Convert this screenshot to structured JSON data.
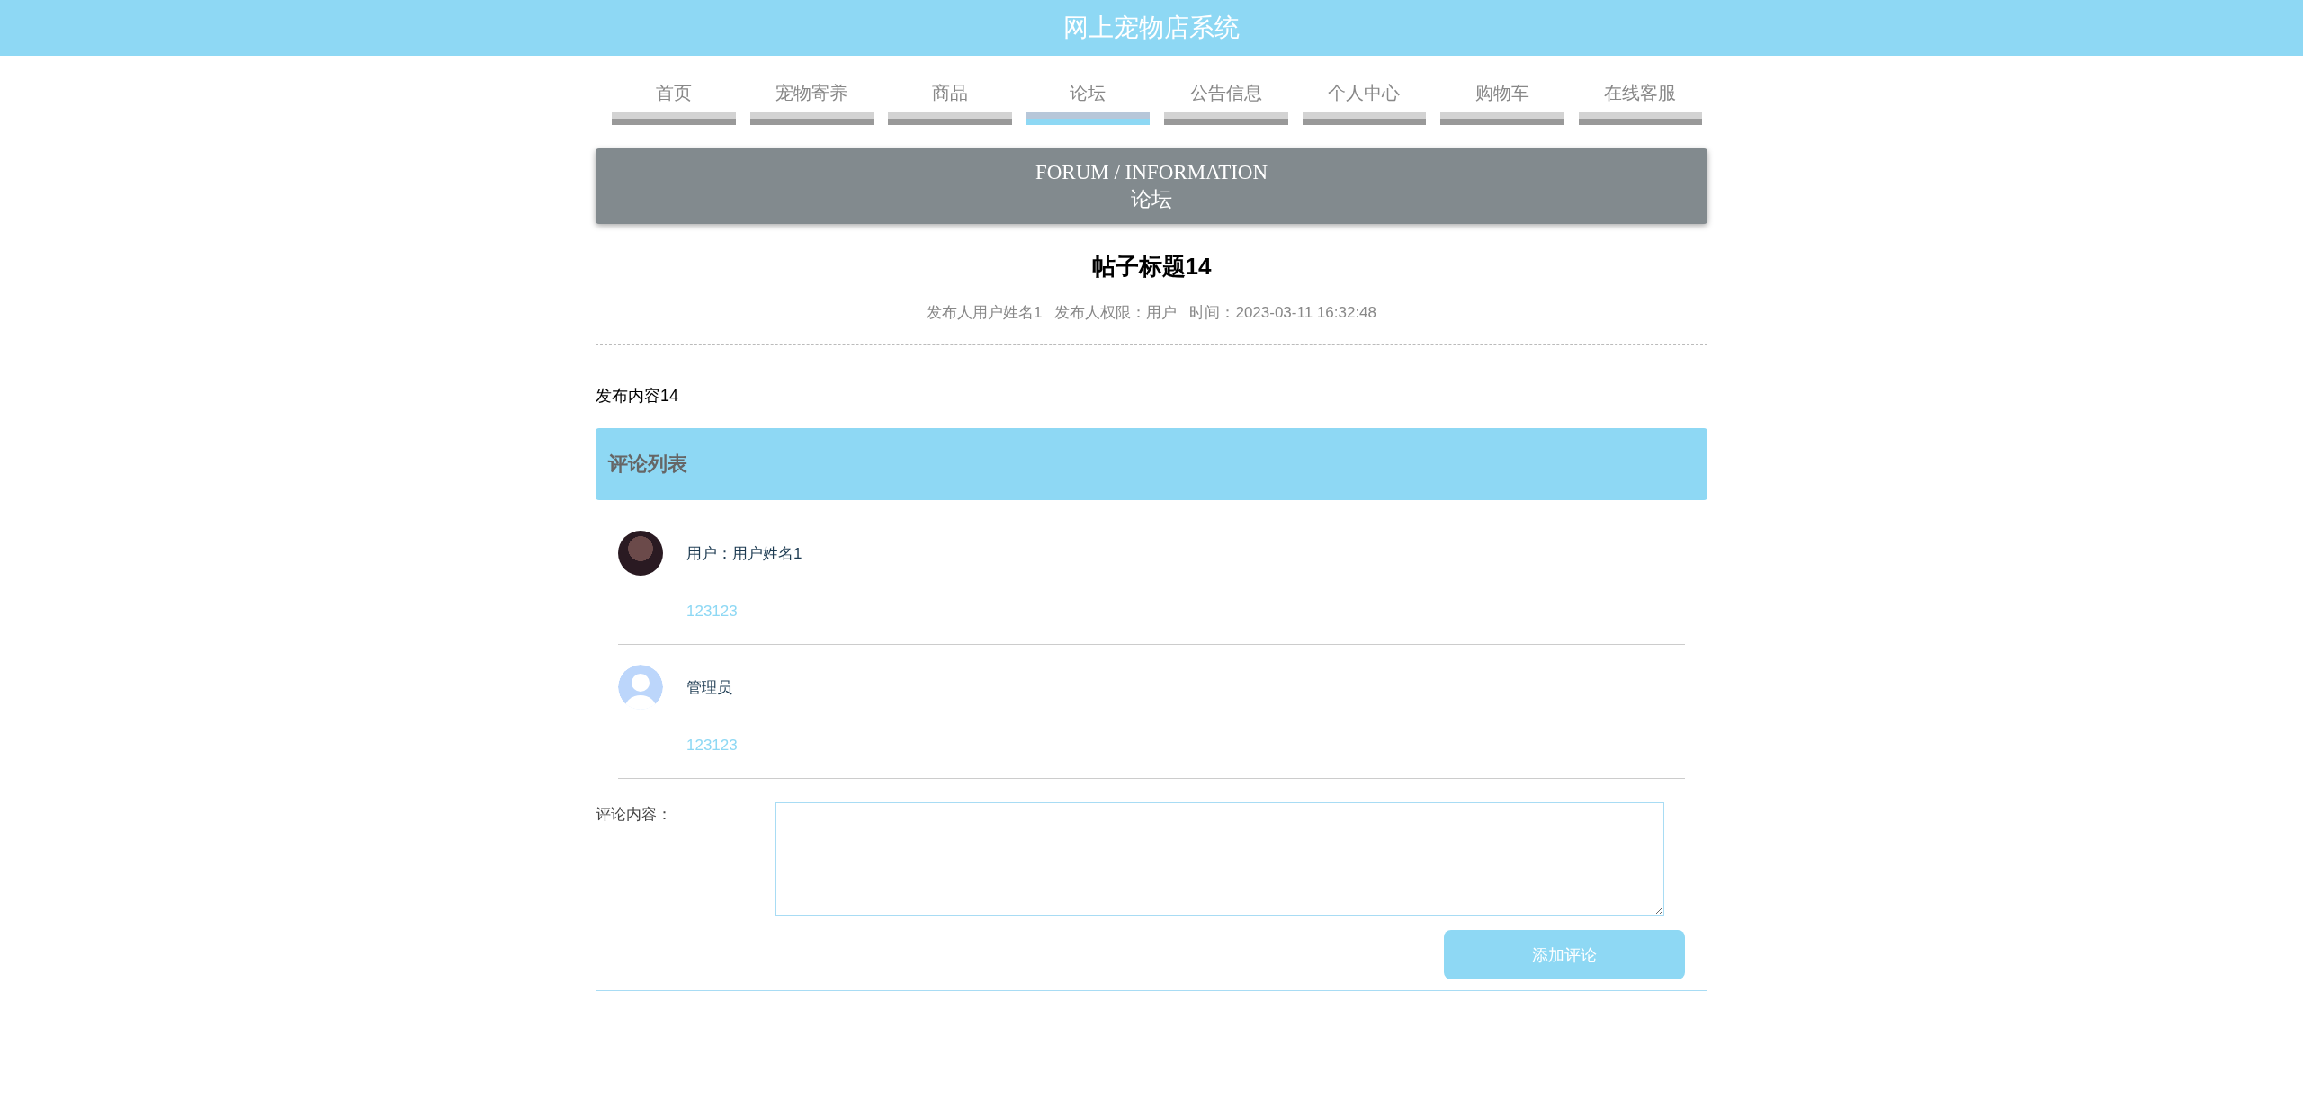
{
  "header": {
    "title": "网上宠物店系统"
  },
  "nav": [
    {
      "label": "首页",
      "selected": false
    },
    {
      "label": "宠物寄养",
      "selected": false
    },
    {
      "label": "商品",
      "selected": false
    },
    {
      "label": "论坛",
      "selected": true
    },
    {
      "label": "公告信息",
      "selected": false
    },
    {
      "label": "个人中心",
      "selected": false
    },
    {
      "label": "购物车",
      "selected": false
    },
    {
      "label": "在线客服",
      "selected": false
    }
  ],
  "banner": {
    "title": "FORUM / INFORMATION",
    "subtitle": "论坛"
  },
  "post": {
    "title": "帖子标题14",
    "author": "发布人用户姓名1",
    "role": "发布人权限：用户",
    "time": "时间：2023-03-11 16:32:48",
    "content": "发布内容14"
  },
  "comments_header": "评论列表",
  "comments": [
    {
      "kind": "photo",
      "name": "用户：用户姓名1",
      "text": "123123"
    },
    {
      "kind": "default",
      "name": "管理员",
      "text": "123123"
    }
  ],
  "form": {
    "label": "评论内容：",
    "button": "添加评论"
  }
}
